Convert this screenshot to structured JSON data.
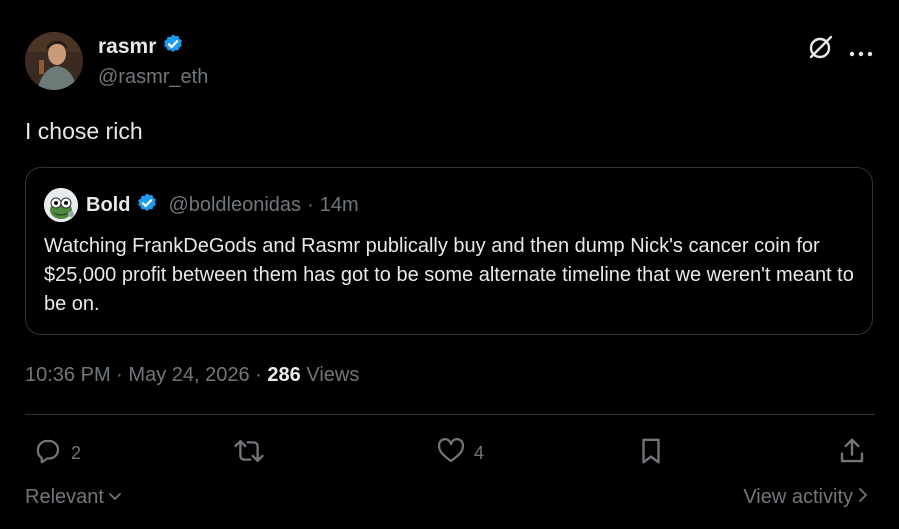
{
  "author": {
    "name": "rasmr",
    "handle": "@rasmr_eth"
  },
  "tweet": {
    "text": "I chose rich"
  },
  "quote": {
    "name": "Bold",
    "handle": "@boldleonidas",
    "separator": "·",
    "time": "14m",
    "text": "Watching FrankDeGods and Rasmr publically buy and then dump Nick's cancer coin for $25,000 profit between them has got to be some alternate timeline that we weren't meant to be on."
  },
  "meta": {
    "time": "10:36 PM",
    "date": "May 24, 2026",
    "separator": "·",
    "views_count": "286",
    "views_label": "Views"
  },
  "actions": {
    "replies": "2",
    "likes": "4"
  },
  "footer": {
    "sort_label": "Relevant",
    "activity_label": "View activity"
  },
  "colors": {
    "verified": "#1d9bf0",
    "background": "#000000",
    "secondary_text": "#71767b",
    "border": "#2f3336"
  }
}
